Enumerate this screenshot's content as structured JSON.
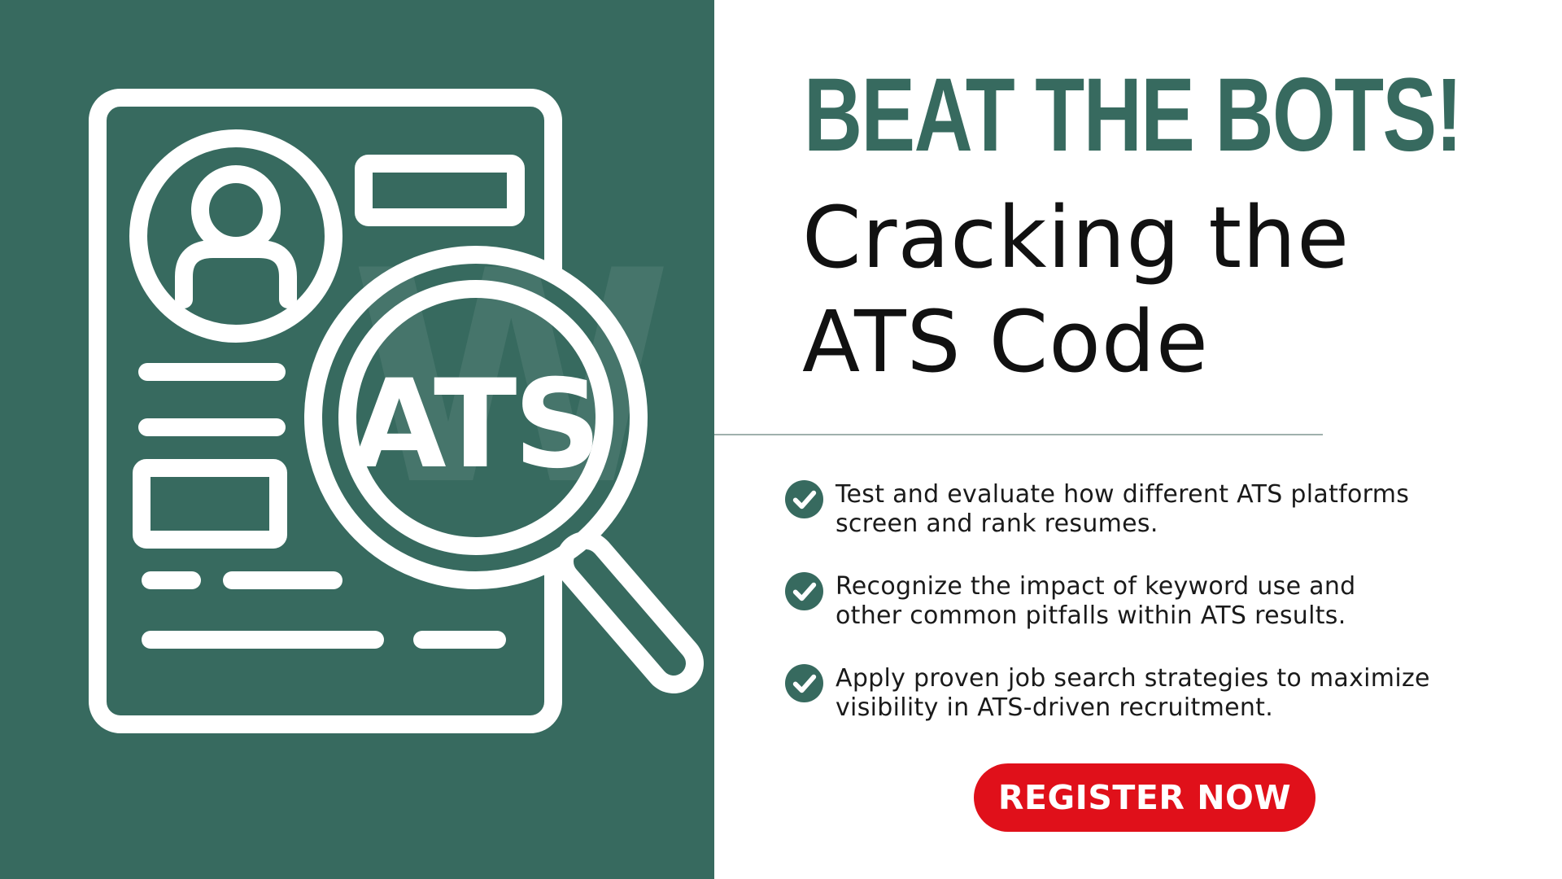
{
  "colors": {
    "brand_green": "#376a5f",
    "cta_red": "#e0101a",
    "background": "#ffffff",
    "text": "#1a1a1a"
  },
  "illustration": {
    "icon": "resume-magnifier-icon",
    "badge_text": "ATS"
  },
  "headline": "BEAT THE BOTS!",
  "subtitle": {
    "line1": "Cracking the",
    "line2": "ATS Code"
  },
  "benefits": [
    {
      "icon": "check-circle-icon",
      "line1": "Test and evaluate how different ATS platforms",
      "line2": "screen and rank resumes."
    },
    {
      "icon": "check-circle-icon",
      "line1": "Recognize the impact of keyword use and",
      "line2": "other common pitfalls within ATS results."
    },
    {
      "icon": "check-circle-icon",
      "line1": "Apply proven job search strategies to maximize",
      "line2": "visibility in ATS-driven recruitment."
    }
  ],
  "cta": {
    "label": "REGISTER NOW"
  }
}
